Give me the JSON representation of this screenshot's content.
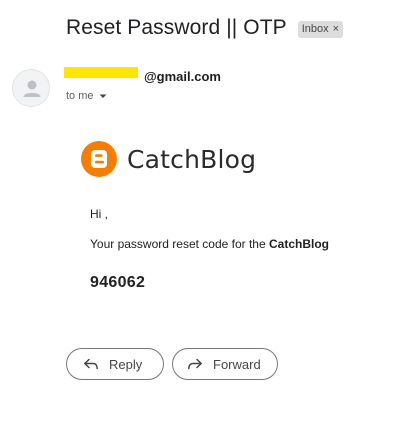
{
  "email": {
    "subject": "Reset Password || OTP",
    "label_chip": "Inbox",
    "label_chip_close": "×",
    "sender_email": "@gmail.com",
    "to_text": "to me"
  },
  "body": {
    "brand_name": "CatchBlog",
    "greeting": "Hi ,",
    "code_prefix": "Your password reset code for the ",
    "code_brand": "CatchBlog",
    "otp": "946062"
  },
  "actions": {
    "reply_label": "Reply",
    "forward_label": "Forward"
  },
  "colors": {
    "brand_orange": "#f57d00",
    "redaction": "#ffe600",
    "chip_bg": "#dddddd"
  },
  "icons": {
    "avatar": "person-icon",
    "to_dropdown": "caret-down-icon",
    "brand": "blogger-logo-icon",
    "reply": "reply-arrow-icon",
    "forward": "forward-arrow-icon"
  }
}
